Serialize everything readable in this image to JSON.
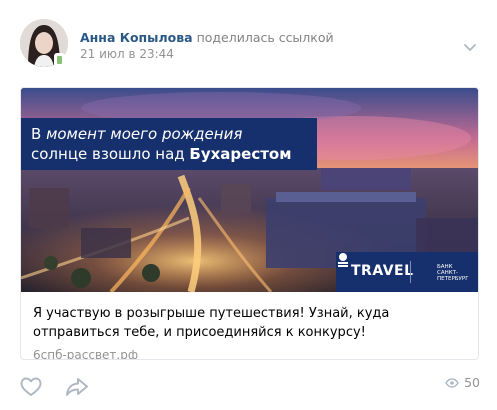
{
  "post": {
    "author_name": "Анна Копылова",
    "action_text": "поделилась ссылкой",
    "date": "21 июл в 23:44",
    "menu_icon": "chevron-down-icon",
    "avatar_icon": "user-photo",
    "online_status": "mobile"
  },
  "attachment": {
    "banner_line1_prefix": "В ",
    "banner_line1_italic": "момент моего рождения",
    "banner_line2_prefix": "солнце взошло над ",
    "banner_line2_bold": "Бухарестом",
    "travel_label": "TRAVEL",
    "bank_line1": "БАНК",
    "bank_line2": "САНКТ-",
    "bank_line3": "ПЕТЕРБУРГ",
    "description": "Я участвую в розыгрыше путешествия! Узнай, куда отправиться тебе, и присоединяйся к конкурсу!",
    "source": "6спб-рассвет.рф",
    "colors": {
      "banner": "#16306d",
      "link": "#2a5885",
      "muted": "#939393"
    }
  },
  "footer": {
    "like_icon": "heart-icon",
    "share_icon": "share-icon",
    "views_icon": "eye-icon",
    "views_count": "50"
  }
}
